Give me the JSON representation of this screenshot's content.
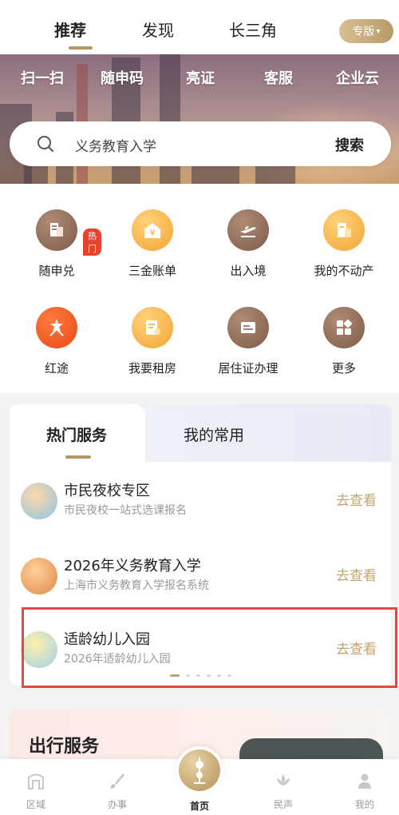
{
  "top_tabs": [
    "推荐",
    "发现",
    "长三角"
  ],
  "special_button": {
    "label": "专版",
    "icon": "chevron-down-icon"
  },
  "quick_actions": [
    "扫一扫",
    "随申码",
    "亮证",
    "客服",
    "企业云"
  ],
  "search": {
    "placeholder": "义务教育入学",
    "button": "搜索",
    "icon": "search-icon"
  },
  "services": [
    {
      "label": "随申兑",
      "icon": "document-icon",
      "badge": "热门"
    },
    {
      "label": "三金账单",
      "icon": "yuan-house-icon"
    },
    {
      "label": "出入境",
      "icon": "airplane-icon"
    },
    {
      "label": "我的不动产",
      "icon": "property-icon"
    },
    {
      "label": "红途",
      "icon": "monument-icon"
    },
    {
      "label": "我要租房",
      "icon": "rent-icon"
    },
    {
      "label": "居住证办理",
      "icon": "id-card-icon"
    },
    {
      "label": "更多",
      "icon": "grid-icon"
    }
  ],
  "hot_card": {
    "tabs": [
      "热门服务",
      "我的常用"
    ],
    "rows": [
      {
        "title": "市民夜校专区",
        "subtitle": "市民夜校一站式选课报名",
        "action": "去查看"
      },
      {
        "title": "2026年义务教育入学",
        "subtitle": "上海市义务教育入学报名系统",
        "action": "去查看"
      },
      {
        "title": "适龄幼儿入园",
        "subtitle": "2026年适龄幼儿入园",
        "action": "去查看"
      }
    ],
    "pager": {
      "total": 6,
      "active": 1
    }
  },
  "travel": {
    "title": "出行服务"
  },
  "bottom_nav": [
    "区域",
    "办事",
    "首页",
    "民声",
    "我的"
  ],
  "colors": {
    "accent": "#b6975f",
    "action": "#c1a470",
    "highlight": "#e8463f",
    "hot": "#e7432c"
  }
}
